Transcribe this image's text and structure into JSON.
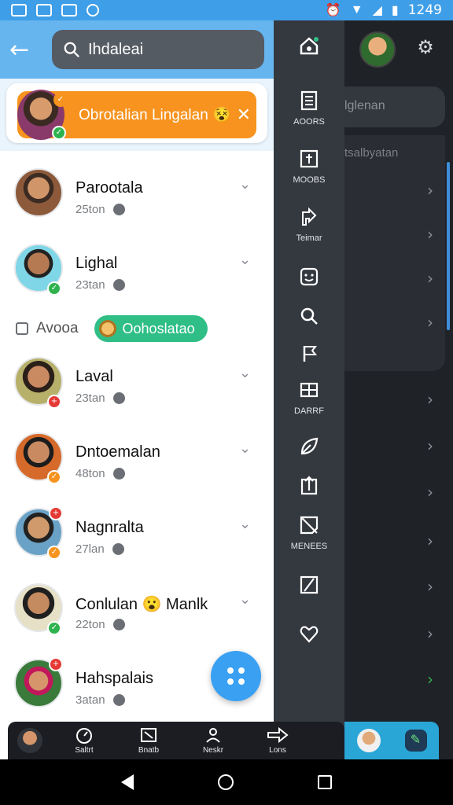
{
  "status": {
    "time": "1249"
  },
  "header": {
    "search_value": "Ihdaleai"
  },
  "banner": {
    "text": "Obrotalian Lingalan 😵",
    "close_icon": "close-icon"
  },
  "contacts": [
    {
      "name": "Parootala",
      "meta": "25ton",
      "badge": "none"
    },
    {
      "name": "Lighal",
      "meta": "23tan",
      "badge": "green"
    },
    {
      "name": "Laval",
      "meta": "23tan",
      "badge": "red"
    },
    {
      "name": "Dntoemalan",
      "meta": "48ton",
      "badge": "orange"
    },
    {
      "name": "Nagnralta",
      "meta": "27lan",
      "badge": "orange"
    },
    {
      "name": "Conlulan 😮 Manlk",
      "meta": "22ton",
      "badge": "green"
    },
    {
      "name": "Hahspalais",
      "meta": "3atan",
      "badge": "red"
    }
  ],
  "tagline": {
    "label": "Avooa",
    "chip": "Oohoslatao"
  },
  "rail": [
    {
      "icon": "home-icon",
      "label": ""
    },
    {
      "icon": "document-icon",
      "label": "AOORS"
    },
    {
      "icon": "add-box-icon",
      "label": "MOOBS"
    },
    {
      "icon": "share-icon",
      "label": "Teimar"
    },
    {
      "icon": "smile-box-icon",
      "label": ""
    },
    {
      "icon": "search-icon",
      "label": ""
    },
    {
      "icon": "flag-icon",
      "label": ""
    },
    {
      "icon": "grid-icon",
      "label": "DARRF"
    },
    {
      "icon": "leaf-icon",
      "label": ""
    },
    {
      "icon": "upload-icon",
      "label": ""
    },
    {
      "icon": "notes-icon",
      "label": "MENEES"
    },
    {
      "icon": "square-slash-icon",
      "label": ""
    },
    {
      "icon": "heart-icon",
      "label": ""
    }
  ],
  "background": {
    "search_text": "lglenan",
    "subtitle": "tsalbyatan"
  },
  "bottombar": {
    "items": [
      "",
      "Saltrt",
      "Bnatb",
      "Neskr",
      "Lons"
    ]
  }
}
